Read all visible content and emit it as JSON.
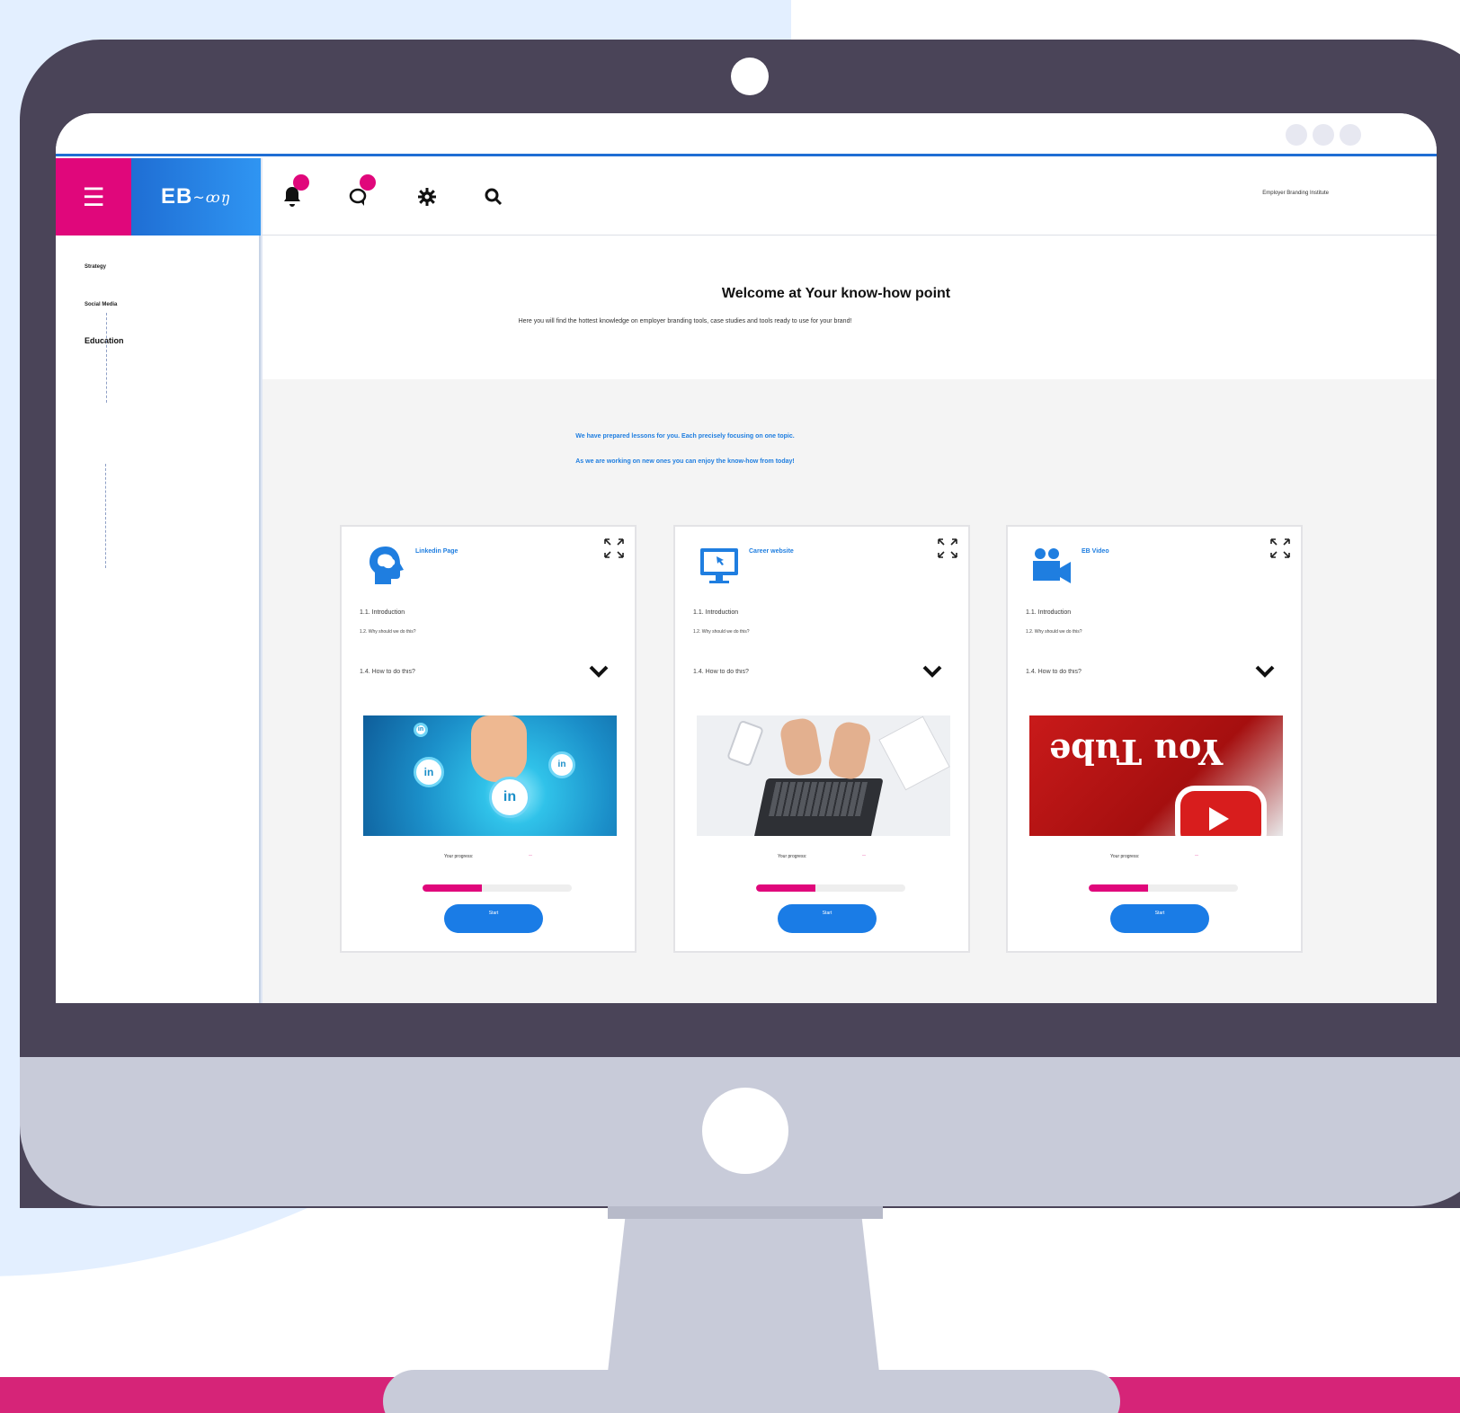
{
  "colors": {
    "accent_pink": "#e0077b",
    "accent_blue": "#1f7ee0",
    "monitor_frame": "#4a4458",
    "monitor_chin": "#c8cbd9"
  },
  "sidebar": {
    "menu_icon": "hamburger-icon",
    "logo_text": "EB",
    "nav": [
      {
        "label": "Strategy"
      },
      {
        "label": "Social Media"
      },
      {
        "label": "Education"
      }
    ]
  },
  "topbar": {
    "icons": [
      "bell-icon",
      "chat-icon",
      "gear-icon",
      "search-icon"
    ],
    "org_name": "Employer Branding Institute"
  },
  "welcome": {
    "title": "Welcome at Your know-how point",
    "subtitle": "Here you will find the hottest knowledge on employer branding tools, case studies and tools ready to use for your brand!"
  },
  "intro": {
    "line1": "We have prepared  lessons for you.  Each  precisely  focusing on one topic.",
    "line2": "As we are working on new ones you can enjoy the know-how from today!"
  },
  "cards": [
    {
      "title": "Linkedin Page",
      "icon": "brain-head-icon",
      "lesson1": "1.1. Introduction",
      "lesson2": "1.2. Why should we do this?",
      "lesson4": "1.4. How to do this?",
      "progress_label": "Your progress:",
      "progress": 0.4,
      "button": "Start"
    },
    {
      "title": "Career website",
      "icon": "monitor-icon",
      "lesson1": "1.1. Introduction",
      "lesson2": "1.2. Why should we do this?",
      "lesson4": "1.4. How to do this?",
      "progress_label": "Your progress:",
      "progress": 0.4,
      "button": "Start"
    },
    {
      "title": "EB Video",
      "icon": "video-camera-icon",
      "lesson1": "1.1. Introduction",
      "lesson2": "1.2. Why should we do this?",
      "lesson4": "1.4. How to do this?",
      "progress_label": "Your progress:",
      "progress": 0.4,
      "button": "Start"
    }
  ]
}
